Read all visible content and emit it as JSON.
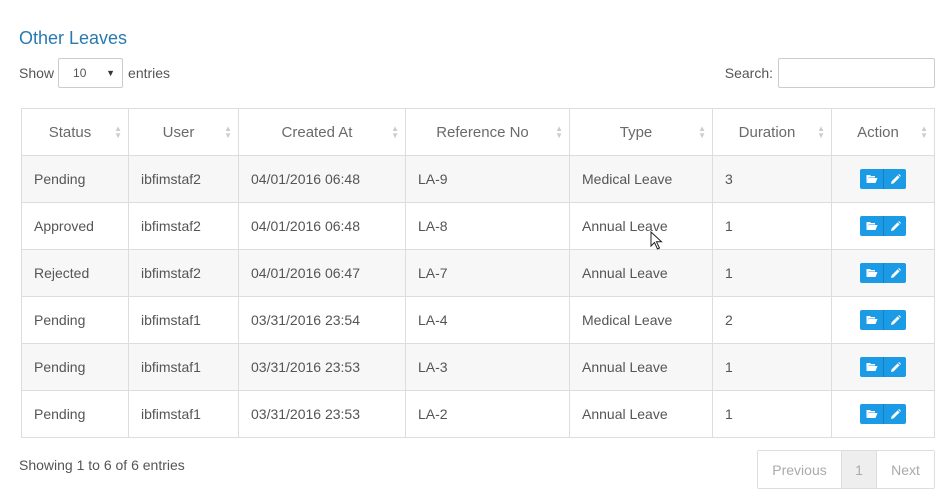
{
  "page": {
    "title": "Other Leaves"
  },
  "length": {
    "prefix": "Show",
    "value": "10",
    "suffix": "entries"
  },
  "search": {
    "label": "Search:",
    "value": ""
  },
  "table": {
    "columns": [
      "Status",
      "User",
      "Created At",
      "Reference No",
      "Type",
      "Duration",
      "Action"
    ],
    "rows": [
      {
        "status": "Pending",
        "user": "ibfimstaf2",
        "created_at": "04/01/2016 06:48",
        "reference_no": "LA-9",
        "type": "Medical Leave",
        "duration": "3"
      },
      {
        "status": "Approved",
        "user": "ibfimstaf2",
        "created_at": "04/01/2016 06:48",
        "reference_no": "LA-8",
        "type": "Annual Leave",
        "duration": "1"
      },
      {
        "status": "Rejected",
        "user": "ibfimstaf2",
        "created_at": "04/01/2016 06:47",
        "reference_no": "LA-7",
        "type": "Annual Leave",
        "duration": "1"
      },
      {
        "status": "Pending",
        "user": "ibfimstaf1",
        "created_at": "03/31/2016 23:54",
        "reference_no": "LA-4",
        "type": "Medical Leave",
        "duration": "2"
      },
      {
        "status": "Pending",
        "user": "ibfimstaf1",
        "created_at": "03/31/2016 23:53",
        "reference_no": "LA-3",
        "type": "Annual Leave",
        "duration": "1"
      },
      {
        "status": "Pending",
        "user": "ibfimstaf1",
        "created_at": "03/31/2016 23:53",
        "reference_no": "LA-2",
        "type": "Annual Leave",
        "duration": "1"
      }
    ],
    "action_icons": [
      "folder-open-icon",
      "pencil-icon"
    ]
  },
  "footer": {
    "info": "Showing 1 to 6 of 6 entries",
    "previous": "Previous",
    "page": "1",
    "next": "Next"
  },
  "colors": {
    "accent": "#2a7ab0",
    "button": "#1b9be6",
    "stripe": "#f7f7f7"
  }
}
